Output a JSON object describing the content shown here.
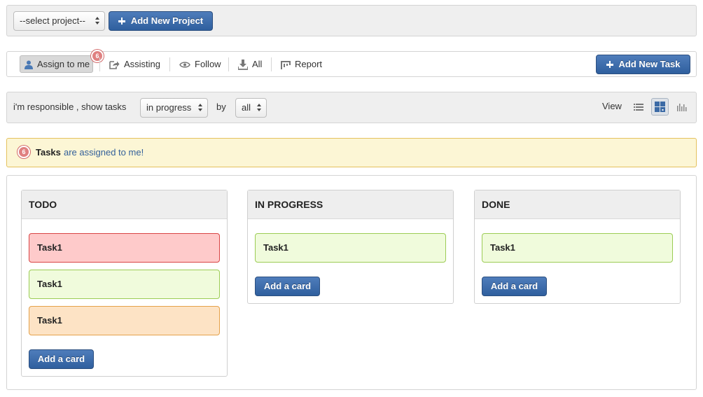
{
  "project_bar": {
    "project_select": "--select project--",
    "add_project_label": "Add New Project"
  },
  "filter_bar": {
    "tabs": [
      {
        "label": "Assign to me",
        "badge": "6",
        "icon": "user-icon",
        "active": true
      },
      {
        "label": "Assisting",
        "icon": "share-icon"
      },
      {
        "label": "Follow",
        "icon": "eye-icon"
      },
      {
        "label": "All",
        "icon": "download-icon"
      },
      {
        "label": "Report",
        "icon": "report-icon"
      }
    ],
    "add_task_label": "Add New Task"
  },
  "show_bar": {
    "prefix": "i'm responsible , show tasks",
    "status_select": "in progress",
    "by_label": "by",
    "by_select": "all",
    "view_label": "View",
    "view_icons": [
      "list-view-icon",
      "board-view-icon",
      "chart-view-icon"
    ],
    "active_view": "board-view-icon"
  },
  "alert": {
    "badge": "6",
    "strong": "Tasks",
    "text": "are assigned to me!"
  },
  "board": {
    "columns": [
      {
        "title": "TODO",
        "cards": [
          {
            "label": "Task1",
            "color": "#fecaca"
          },
          {
            "label": "Task1",
            "color": "#f0fbdc"
          },
          {
            "label": "Task1",
            "color": "#fde3c5"
          }
        ],
        "add_label": "Add a card"
      },
      {
        "title": "IN PROGRESS",
        "cards": [
          {
            "label": "Task1",
            "color": "#f0fbdc"
          }
        ],
        "add_label": "Add a card"
      },
      {
        "title": "DONE",
        "cards": [
          {
            "label": "Task1",
            "color": "#f0fbdc"
          }
        ],
        "add_label": "Add a card"
      }
    ]
  },
  "colors": {
    "primary_button": "#2f5f9e",
    "alert_bg": "#fcf6d5",
    "badge": "#e08080"
  }
}
